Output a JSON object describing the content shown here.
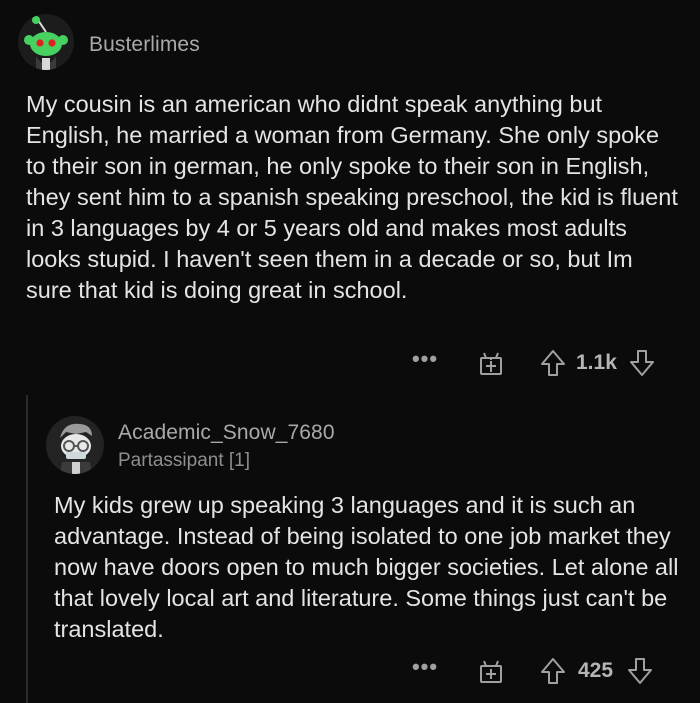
{
  "comments": [
    {
      "username": "Busterlimes",
      "flair": "",
      "body": "My cousin is an american who didnt speak anything but English, he married a woman from Germany.  She only spoke to their son in german, he only spoke to their son in English, they sent him to a spanish speaking preschool, the kid is fluent in 3 languages by 4 or 5 years old and makes most adults looks stupid.  I haven't seen them in a decade or so, but Im sure that kid is doing great in school.",
      "votes": "1.1k",
      "avatar_icon": "snoo-avatar-icon"
    },
    {
      "username": "Academic_Snow_7680",
      "flair": "Partassipant [1]",
      "body": "My kids grew up speaking 3 languages and it is such an advantage. Instead of being isolated to one job market they now have doors open to much bigger societies. Let alone all that lovely local art and literature. Some things just can't be translated.",
      "votes": "425",
      "avatar_icon": "snoo-avatar-icon"
    }
  ],
  "actions": {
    "more": "•••",
    "more_icon": "more-options-icon",
    "award_icon": "award-gift-icon",
    "upvote_icon": "upvote-arrow-icon",
    "downvote_icon": "downvote-arrow-icon"
  },
  "colors": {
    "background": "#0b0b0b",
    "text": "#e4e4e4",
    "muted": "#a9a9a9",
    "snoo_green": "#46d160"
  }
}
